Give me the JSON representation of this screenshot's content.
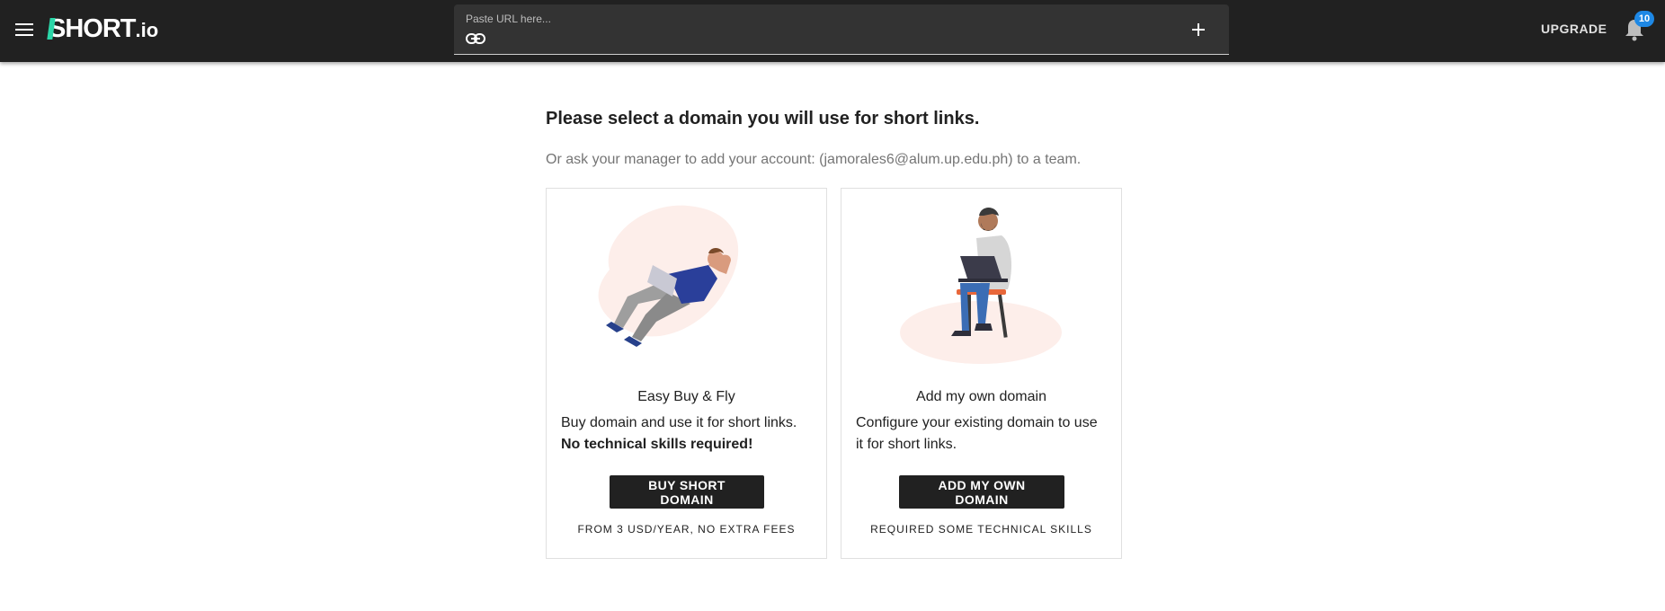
{
  "header": {
    "logo_text": "SHORT",
    "logo_tld": ".io",
    "url_placeholder": "Paste URL here...",
    "upgrade_label": "UPGRADE",
    "notification_count": "10"
  },
  "main": {
    "heading": "Please select a domain you will use for short links.",
    "subheading": "Or ask your manager to add your account: (jamorales6@alum.up.edu.ph) to a team."
  },
  "cards": {
    "buy": {
      "title": "Easy Buy & Fly",
      "description": "Buy domain and use it for short links.",
      "emphasis": "No technical skills required!",
      "button_label": "BUY SHORT DOMAIN",
      "note": "FROM 3 USD/YEAR, NO EXTRA FEES"
    },
    "own": {
      "title": "Add my own domain",
      "description": "Configure your existing domain to use it for short links.",
      "button_label": "ADD MY OWN DOMAIN",
      "note": "REQUIRED SOME TECHNICAL SKILLS"
    }
  },
  "colors": {
    "topbar": "#212121",
    "logo_accent": "#2bd6a8",
    "badge": "#1e88e5",
    "button": "#212121"
  },
  "icons": {
    "menu": "menu-icon",
    "link": "link-icon",
    "add": "plus-icon",
    "notifications": "bell-icon"
  }
}
